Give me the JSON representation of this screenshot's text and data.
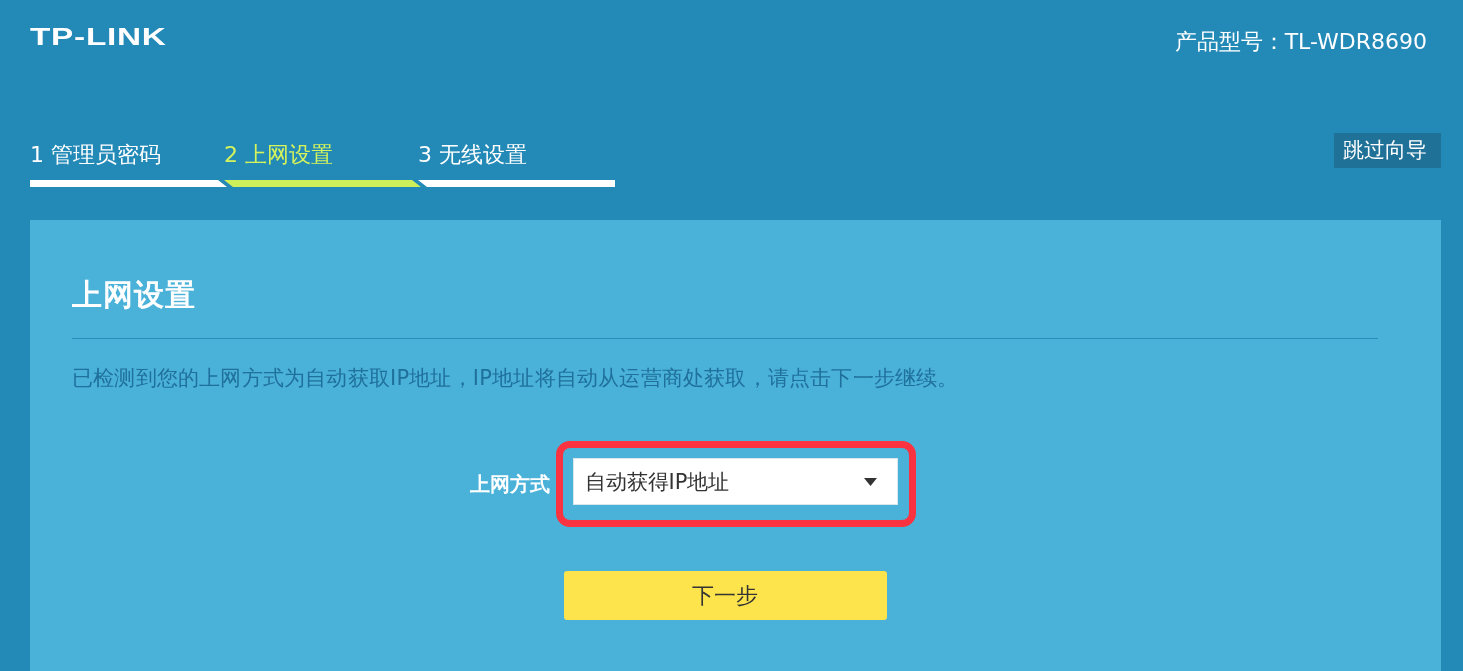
{
  "header": {
    "logo": "TP-LINK",
    "model": "产品型号：TL-WDR8690"
  },
  "steps": [
    {
      "label": "1 管理员密码",
      "selected": false
    },
    {
      "label": "2 上网设置",
      "selected": true
    },
    {
      "label": "3 无线设置",
      "selected": false
    }
  ],
  "skip_button": "跳过向导",
  "panel": {
    "title": "上网设置",
    "description": "已检测到您的上网方式为自动获取IP地址，IP地址将自动从运营商处获取，请点击下一步继续。",
    "connection": {
      "label": "上网方式",
      "value": "自动获得IP地址",
      "highlighted": true
    },
    "next_button": "下一步"
  }
}
